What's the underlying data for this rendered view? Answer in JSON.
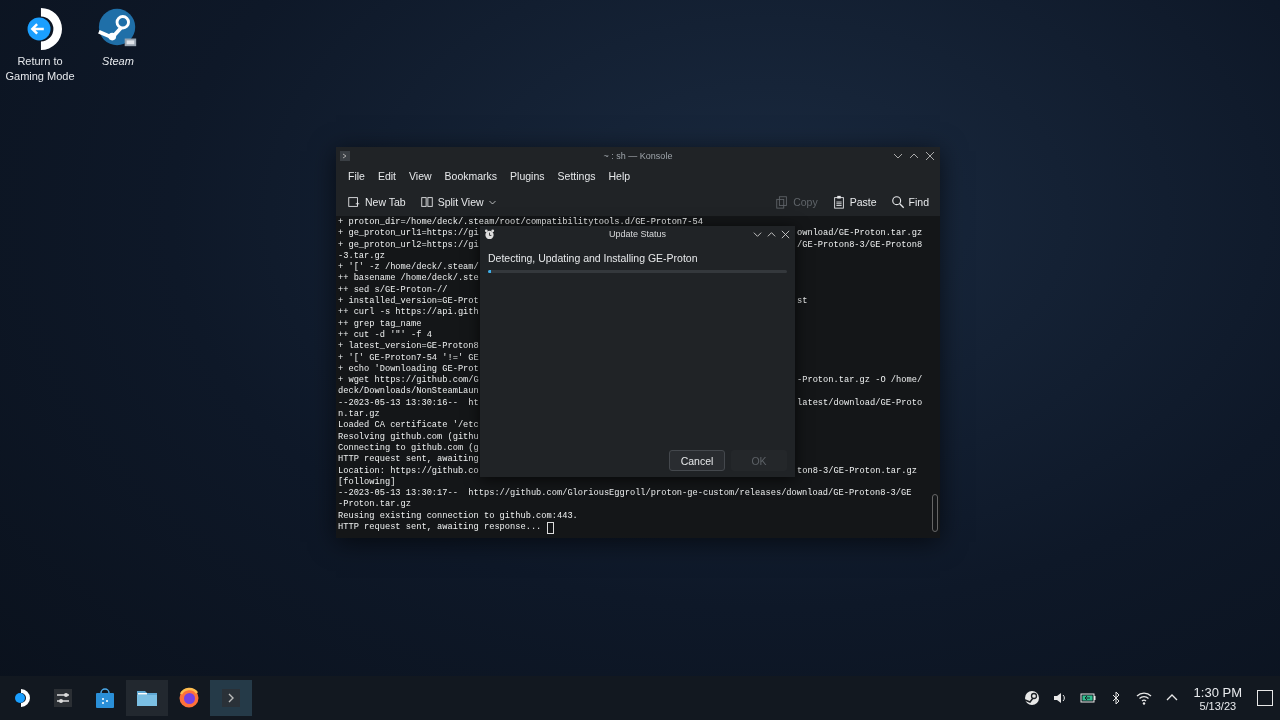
{
  "desktop_icons": [
    {
      "kind": "return",
      "label": "Return to Gaming Mode",
      "link": false
    },
    {
      "kind": "steam",
      "label": "Steam",
      "link": true
    }
  ],
  "konsole": {
    "title": "~ : sh — Konsole",
    "menu": [
      "File",
      "Edit",
      "View",
      "Bookmarks",
      "Plugins",
      "Settings",
      "Help"
    ],
    "toolbar": [
      {
        "kind": "new-tab",
        "label": "New Tab",
        "disabled": false
      },
      {
        "kind": "split-view",
        "label": "Split View",
        "disabled": false
      },
      {
        "kind": "copy",
        "label": "Copy",
        "disabled": true
      },
      {
        "kind": "paste",
        "label": "Paste",
        "disabled": false
      },
      {
        "kind": "find",
        "label": "Find",
        "disabled": false
      }
    ],
    "terminal": {
      "lines": [
        {
          "text": "+ proton_dir=/home/deck/.steam/root/compatibilitytools.d/GE-Proton7-54"
        },
        {
          "text": "+ ge_proton_url1=https://gi",
          "right": "ownload/GE-Proton.tar.gz"
        },
        {
          "text": "+ ge_proton_url2=https://gi",
          "right": "/GE-Proton8-3/GE-Proton8"
        },
        {
          "text": "-3.tar.gz"
        },
        {
          "text": "+ '[' -z /home/deck/.steam/"
        },
        {
          "text": "++ basename /home/deck/.ste"
        },
        {
          "text": "++ sed s/GE-Proton-//"
        },
        {
          "text": "+ installed_version=GE-Prot",
          "right": "st"
        },
        {
          "text": "++ curl -s https://api.gith"
        },
        {
          "text": "++ grep tag_name"
        },
        {
          "text": "++ cut -d '\"' -f 4"
        },
        {
          "text": "+ latest_version=GE-Proton8"
        },
        {
          "text": "+ '[' GE-Proton7-54 '!=' GE"
        },
        {
          "text": "+ echo 'Downloading GE-Prot"
        },
        {
          "text": "+ wget https://github.com/G",
          "right": "-Proton.tar.gz -O /home/"
        },
        {
          "text": "deck/Downloads/NonSteamLaun"
        },
        {
          "text": "--2023-05-13 13:30:16--  ht",
          "right": "latest/download/GE-Proto"
        },
        {
          "text": "n.tar.gz"
        },
        {
          "text": "Loaded CA certificate '/etc"
        },
        {
          "text": "Resolving github.com (githu"
        },
        {
          "text": "Connecting to github.com (g"
        },
        {
          "text": "HTTP request sent, awaiting"
        },
        {
          "text": "Location: https://github.co",
          "right": "ton8-3/GE-Proton.tar.gz"
        },
        {
          "text": "[following]"
        },
        {
          "text": "--2023-05-13 13:30:17--  https://github.com/GloriousEggroll/proton-ge-custom/releases/download/GE-Proton8-3/GE"
        },
        {
          "text": "-Proton.tar.gz"
        },
        {
          "text": "Reusing existing connection to github.com:443."
        },
        {
          "text": "HTTP request sent, awaiting response... ",
          "cursor": true
        }
      ]
    }
  },
  "dialog": {
    "title": "Update Status",
    "message": "Detecting, Updating and Installing GE-Proton",
    "progress": {
      "level": 0.01
    },
    "buttons": [
      {
        "label": "Cancel",
        "disabled": false
      },
      {
        "label": "OK",
        "disabled": true
      }
    ]
  },
  "taskbar": {
    "launchers": [
      {
        "kind": "steamdeck",
        "running": false,
        "selected": false
      },
      {
        "kind": "sliders",
        "running": false,
        "selected": false
      },
      {
        "kind": "store",
        "running": false,
        "selected": false
      },
      {
        "kind": "folder",
        "running": true,
        "selected": false
      },
      {
        "kind": "browser",
        "running": false,
        "selected": false
      },
      {
        "kind": "terminal",
        "running": true,
        "selected": true
      }
    ],
    "tray": [
      {
        "kind": "steam"
      },
      {
        "kind": "volume"
      },
      {
        "kind": "battery"
      },
      {
        "kind": "bluetooth"
      },
      {
        "kind": "wifi"
      },
      {
        "kind": "expand"
      }
    ],
    "clock": {
      "time": "1:30 PM",
      "date": "5/13/23"
    }
  }
}
